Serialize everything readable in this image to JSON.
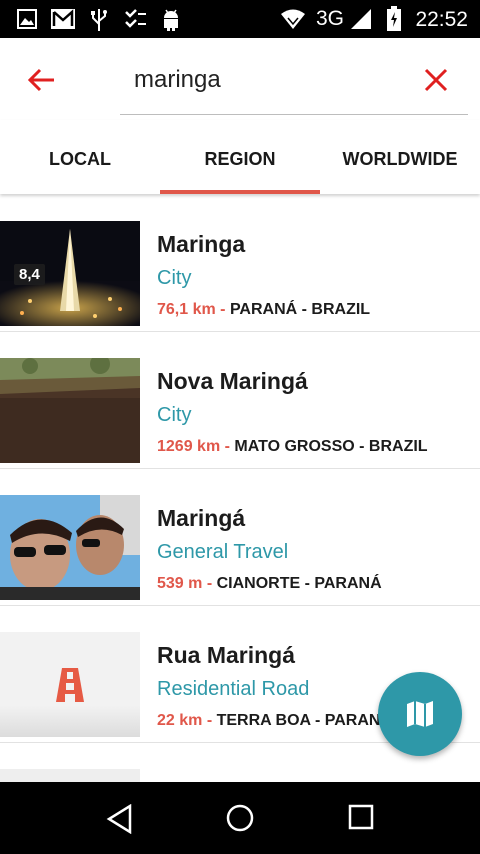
{
  "status_bar": {
    "network": "3G",
    "time": "22:52"
  },
  "search": {
    "query": "maringa"
  },
  "tabs": [
    {
      "label": "LOCAL"
    },
    {
      "label": "REGION",
      "selected": true
    },
    {
      "label": "WORLDWIDE"
    }
  ],
  "results": [
    {
      "title": "Maringa",
      "type": "City",
      "distance": "76,1 km -",
      "location": "PARANÁ - BRAZIL",
      "rating": "8,4"
    },
    {
      "title": "Nova Maringá",
      "type": "City",
      "distance": "1269 km -",
      "location": "MATO GROSSO - BRAZIL"
    },
    {
      "title": "Maringá",
      "type": "General Travel",
      "distance": "539 m -",
      "location": "CIANORTE - PARANÁ"
    },
    {
      "title": "Rua Maringá",
      "type": "Residential Road",
      "distance": "22 km -",
      "location": "TERRA BOA - PARANÁ"
    }
  ],
  "colors": {
    "accent_red": "#e0574a",
    "teal": "#2e98a8"
  },
  "icons": {
    "back": "arrow-left-icon",
    "clear": "close-icon",
    "fab": "map-icon"
  }
}
